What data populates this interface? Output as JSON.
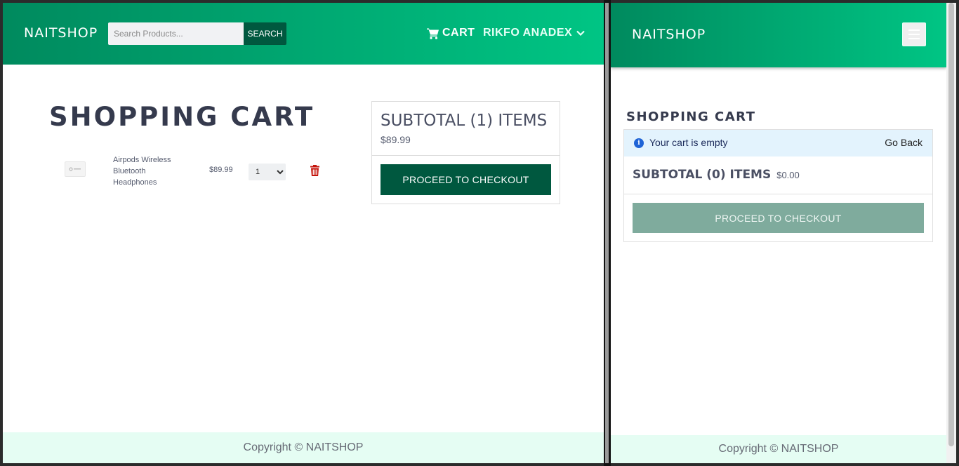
{
  "left": {
    "brand": "NAITSHOP",
    "search": {
      "placeholder": "Search Products...",
      "button_label": "SEARCH"
    },
    "nav": {
      "cart_label": "CART",
      "user_label": "RIKFO ANADEX"
    },
    "page_title": "SHOPPING CART",
    "cart_items": [
      {
        "name": "Airpods Wireless Bluetooth Headphones",
        "price": "$89.99",
        "quantity": "1"
      }
    ],
    "summary": {
      "title": "SUBTOTAL (1) ITEMS",
      "amount": "$89.99",
      "checkout_label": "PROCEED TO CHECKOUT"
    },
    "footer": "Copyright © NAITSHOP"
  },
  "right": {
    "brand": "NAITSHOP",
    "page_title": "SHOPPING CART",
    "alert": {
      "message": "Your cart is empty",
      "link": "Go Back"
    },
    "summary": {
      "title": "SUBTOTAL (0) ITEMS",
      "amount": "$0.00",
      "checkout_label": "PROCEED TO CHECKOUT"
    },
    "footer": "Copyright © NAITSHOP"
  },
  "colors": {
    "navbar_start": "#008a5e",
    "navbar_end": "#00c584",
    "primary_button": "#00583f",
    "disabled_button": "#7fab9d",
    "delete_icon": "#c4150c",
    "footer_bg": "#e5fdf3",
    "alert_bg": "#e3f3fd"
  },
  "icons": {
    "cart": "shopping-cart-icon",
    "user_menu": "chevron-down-icon",
    "delete": "trash-icon",
    "menu": "hamburger-menu-icon",
    "info": "info-icon"
  }
}
